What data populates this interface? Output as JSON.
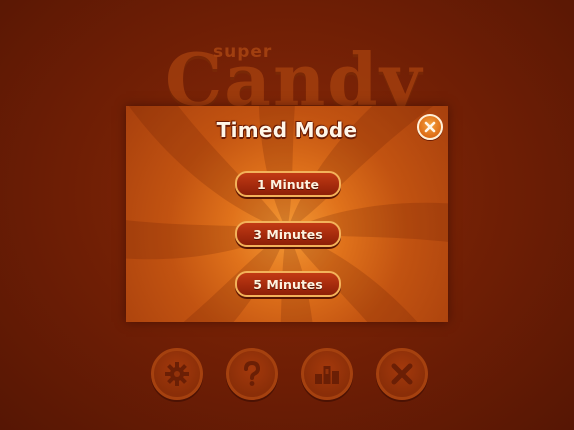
{
  "background": {
    "logo_small": "super",
    "logo_large": "Candy"
  },
  "modal": {
    "title": "Timed Mode",
    "close_icon": "close-icon",
    "options": [
      {
        "label": "1 Minute"
      },
      {
        "label": "3 Minutes"
      },
      {
        "label": "5 Minutes"
      }
    ]
  },
  "bottom_bar": {
    "icons": [
      "gear-icon",
      "help-icon",
      "leaderboard-icon",
      "exit-icon"
    ]
  },
  "colors": {
    "background": "#6e1e05",
    "modal_center": "#f39a36",
    "modal_edge": "#a8400d",
    "button_fill": "#c23a14",
    "button_border": "#f3b25a",
    "text": "#fff3df"
  }
}
